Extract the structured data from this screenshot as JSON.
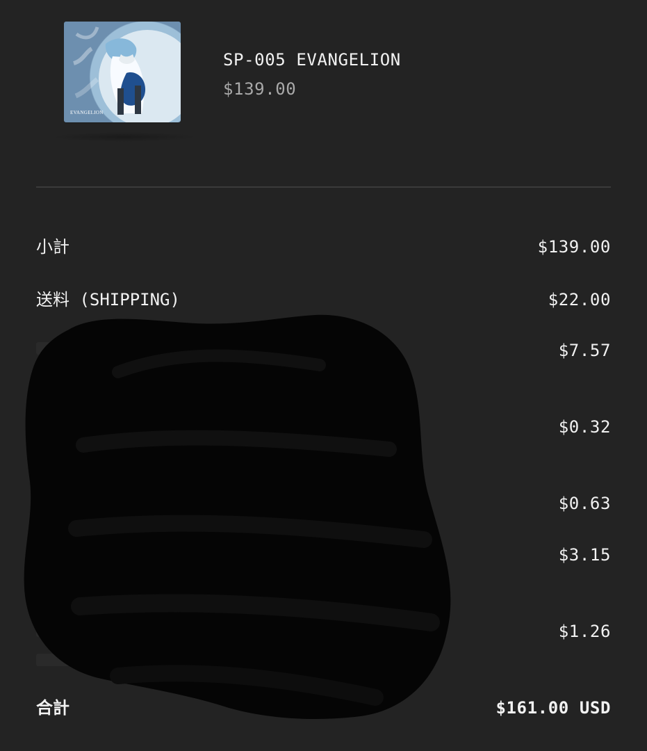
{
  "product": {
    "title": "SP-005 EVANGELION",
    "price": "$139.00",
    "thumbnail_text": "EVANGELION"
  },
  "summary": {
    "subtotal_label": "小計",
    "subtotal_value": "$139.00",
    "shipping_label": "送料 (SHIPPING)",
    "shipping_value": "$22.00",
    "redacted_rows": [
      {
        "value": "$7.57"
      },
      {
        "value": "$0.32"
      },
      {
        "value": "$0.63"
      },
      {
        "value": "$3.15"
      },
      {
        "value": "$1.26"
      }
    ],
    "total_label": "合計",
    "total_value": "$161.00 USD"
  },
  "colors": {
    "background": "#232323",
    "text": "#f2f2f2",
    "muted": "#a9a9a9",
    "divider": "#3b3b3b",
    "redaction": "#050505"
  }
}
